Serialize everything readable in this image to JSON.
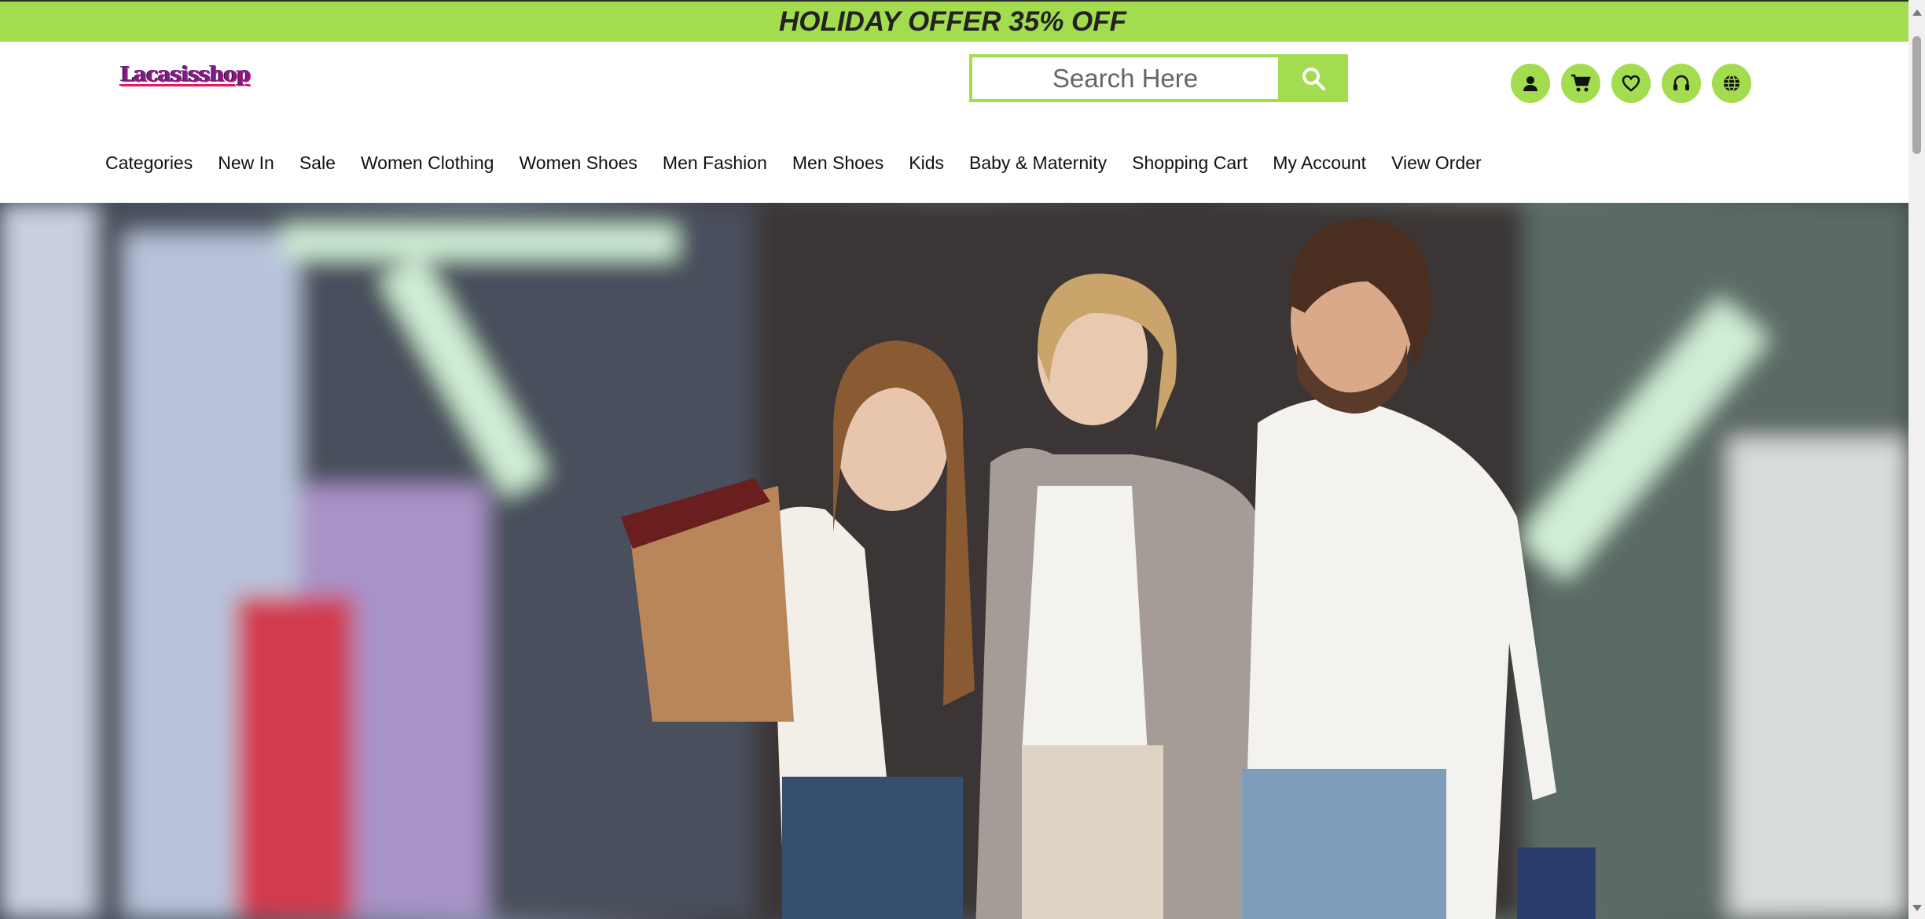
{
  "promo": {
    "text": "HOLIDAY OFFER 35% OFF"
  },
  "logo": {
    "text": "Lacasisshop"
  },
  "search": {
    "placeholder": "Search Here",
    "button_icon": "search-icon"
  },
  "header_icons": [
    {
      "name": "account-icon"
    },
    {
      "name": "cart-icon"
    },
    {
      "name": "wishlist-icon"
    },
    {
      "name": "support-icon"
    },
    {
      "name": "language-icon"
    }
  ],
  "nav": {
    "items": [
      "Categories",
      "New In",
      "Sale",
      "Women Clothing",
      "Women Shoes",
      "Men Fashion",
      "Men Shoes",
      "Kids",
      "Baby & Maternity",
      "Shopping Cart",
      "My Account",
      "View Order"
    ]
  },
  "hero": {
    "description_hidden": true
  },
  "colors": {
    "accent": "#a4dc4f",
    "text": "#111111"
  }
}
